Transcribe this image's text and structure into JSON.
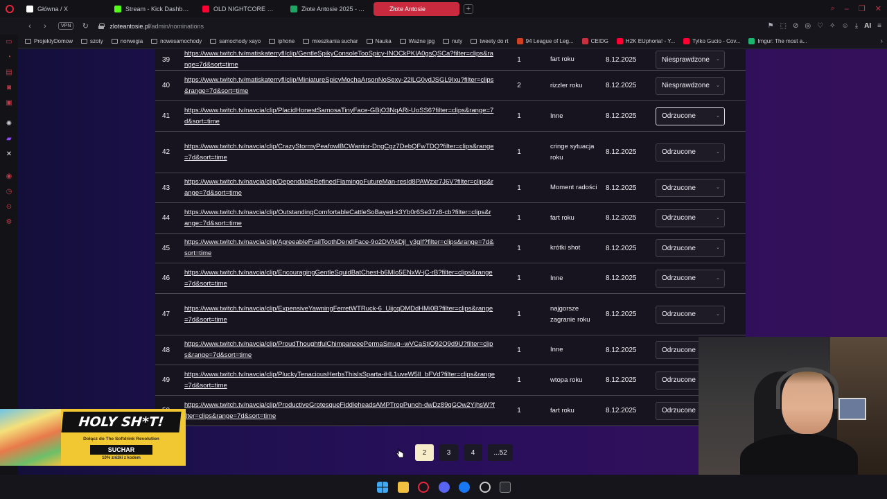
{
  "browser": {
    "tabs": [
      {
        "label": "Główna / X",
        "icon": "x-icon",
        "color": "#ffffff"
      },
      {
        "label": "Stream - Kick Dashboard",
        "icon": "kick-icon",
        "color": "#53fc18"
      },
      {
        "label": "OLD NIGHTCORE MIX *20",
        "icon": "youtube-icon",
        "color": "#ff0033"
      },
      {
        "label": "Złote Antosie 2025 - Arku",
        "icon": "sheets-icon",
        "color": "#1fa463"
      },
      {
        "label": "Złote Antosie",
        "icon": "site-icon",
        "color": "#c92a3d"
      }
    ],
    "url_host": "zloteantosie.pl",
    "url_path": "/admin/nominations",
    "vpn_label": "VPN",
    "ai_label": "AI",
    "bookmarks": [
      {
        "label": "ProjektyDomow",
        "icon": "folder-icon"
      },
      {
        "label": "szoty",
        "icon": "folder-icon"
      },
      {
        "label": "norwegia",
        "icon": "folder-icon"
      },
      {
        "label": "nowesamochody",
        "icon": "folder-icon"
      },
      {
        "label": "samochody xayo",
        "icon": "folder-icon"
      },
      {
        "label": "iphone",
        "icon": "folder-icon"
      },
      {
        "label": "mieszkania suchar",
        "icon": "folder-icon"
      },
      {
        "label": "Nauka",
        "icon": "folder-icon"
      },
      {
        "label": "Ważne jpg",
        "icon": "folder-icon"
      },
      {
        "label": "nuty",
        "icon": "folder-icon"
      },
      {
        "label": "tweety do rt",
        "icon": "folder-icon"
      },
      {
        "label": "94 League of Leg...",
        "icon": "lol-icon",
        "color": "#d04020"
      },
      {
        "label": "CEIDG",
        "icon": "ceidg-icon",
        "color": "#c83040"
      },
      {
        "label": "H2K EUphoria! - Y...",
        "icon": "youtube-icon",
        "color": "#ff0033"
      },
      {
        "label": "Tylko Gucio - Cov...",
        "icon": "youtube-icon",
        "color": "#ff0033"
      },
      {
        "label": "Imgur: The most a...",
        "icon": "imgur-icon",
        "color": "#1bb76e"
      }
    ]
  },
  "nominations": [
    {
      "num": "39",
      "link": "https://www.twitch.tv/matiskaterryfl/clip/GentleSpikyConsoleTooSpicy-INOCkPKIA0gsQSCa?filter=clips&range=7d&sort=time",
      "votes": "1",
      "category": "fart roku",
      "date": "8.12.2025",
      "status": "Niesprawdzone"
    },
    {
      "num": "40",
      "link": "https://www.twitch.tv/matiskaterryfl/clip/MiniatureSpicyMochaArsonNoSexy-22lLG0ydJSGL9Ixu?filter=clips&range=7d&sort=time",
      "votes": "2",
      "category": "rizzler roku",
      "date": "8.12.2025",
      "status": "Niesprawdzone"
    },
    {
      "num": "41",
      "link": "https://www.twitch.tv/navcia/clip/PlacidHonestSamosaTinyFace-GBjO3NqARi-UoSS6?filter=clips&range=7d&sort=time",
      "votes": "1",
      "category": "Inne",
      "date": "8.12.2025",
      "status": "Odrzucone"
    },
    {
      "num": "42",
      "link": "https://www.twitch.tv/navcia/clip/CrazyStormyPeafowlBCWarrior-DngCgz7DebQFwTDQ?filter=clips&range=7d&sort=time",
      "votes": "1",
      "category": "cringe sytuacja roku",
      "date": "8.12.2025",
      "status": "Odrzucone"
    },
    {
      "num": "43",
      "link": "https://www.twitch.tv/navcia/clip/DependableRefinedFlamingoFutureMan-resId8PAWzxr7J6V?filter=clips&range=7d&sort=time",
      "votes": "1",
      "category": "Moment radości",
      "date": "8.12.2025",
      "status": "Odrzucone"
    },
    {
      "num": "44",
      "link": "https://www.twitch.tv/navcia/clip/OutstandingComfortableCattleSoBayed-k3Yb0r6Se37z8-cb?filter=clips&range=7d&sort=time",
      "votes": "1",
      "category": "fart roku",
      "date": "8.12.2025",
      "status": "Odrzucone"
    },
    {
      "num": "45",
      "link": "https://www.twitch.tv/navcia/clip/AgreeableFrailToothDendiFace-9o2DVAkDjl_y3gIf?filter=clips&range=7d&sort=time",
      "votes": "1",
      "category": "krótki shot",
      "date": "8.12.2025",
      "status": "Odrzucone"
    },
    {
      "num": "46",
      "link": "https://www.twitch.tv/navcia/clip/EncouragingGentleSquidBatChest-b6MIo5ENxW-jC-rB?filter=clips&range=7d&sort=time",
      "votes": "1",
      "category": "Inne",
      "date": "8.12.2025",
      "status": "Odrzucone"
    },
    {
      "num": "47",
      "link": "https://www.twitch.tv/navcia/clip/ExpensiveYawningFerretWTRuck-6_UijcqDMDdHMi0B?filter=clips&range=7d&sort=time",
      "votes": "1",
      "category": "najgorsze zagranie roku",
      "date": "8.12.2025",
      "status": "Odrzucone"
    },
    {
      "num": "48",
      "link": "https://www.twitch.tv/navcia/clip/ProudThoughtfulChimpanzeePermaSmug--wVCaStjQ92O9d9U?filter=clips&range=7d&sort=time",
      "votes": "1",
      "category": "Inne",
      "date": "8.12.2025",
      "status": "Odrzucone"
    },
    {
      "num": "49",
      "link": "https://www.twitch.tv/navcia/clip/PluckyTenaciousHerbsThisIsSparta-iHL1uveW5lI_bFVd?filter=clips&range=7d&sort=time",
      "votes": "1",
      "category": "wtopa roku",
      "date": "8.12.2025",
      "status": "Odrzucone"
    },
    {
      "num": "50",
      "link": "https://www.twitch.tv/navcia/clip/ProductiveGrotesqueFiddleheadsAMPTropPunch-dwDz89qGOw2YjhsW?filter=clips&range=7d&sort=time",
      "votes": "1",
      "category": "fart roku",
      "date": "8.12.2025",
      "status": "Odrzucone"
    }
  ],
  "pagination": {
    "pages": [
      "2",
      "3",
      "4",
      "...52"
    ],
    "current": "2"
  },
  "ad": {
    "headline": "HOLY SH*T!",
    "line": "Dołącz do The Softdrink Revolution",
    "code": "SUCHAR",
    "discount": "10% zniżki z kodem"
  }
}
